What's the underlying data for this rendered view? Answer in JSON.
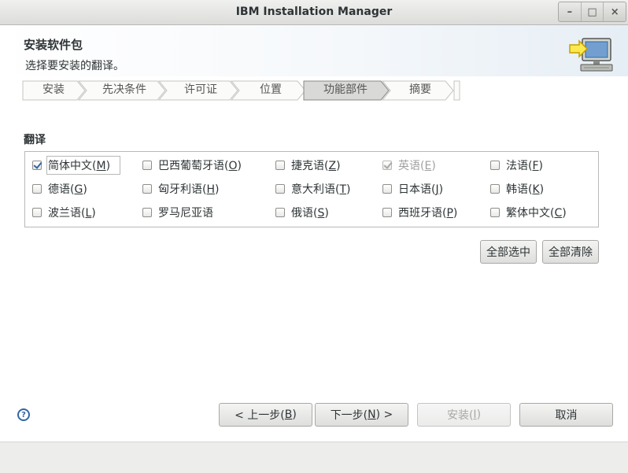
{
  "window": {
    "title": "IBM Installation Manager",
    "controls": [
      "–",
      "□",
      "×"
    ]
  },
  "header": {
    "title": "安装软件包",
    "subtitle": "选择要安装的翻译。",
    "icon": "computer-arrow-icon"
  },
  "steps": [
    {
      "label": "安装",
      "active": false
    },
    {
      "label": "先决条件",
      "active": false
    },
    {
      "label": "许可证",
      "active": false
    },
    {
      "label": "位置",
      "active": false
    },
    {
      "label": "功能部件",
      "active": true
    },
    {
      "label": "摘要",
      "active": false
    }
  ],
  "section": {
    "label": "翻译"
  },
  "languages": [
    {
      "label": "简体中文(M)",
      "checked": true,
      "disabled": false,
      "focused": true
    },
    {
      "label": "巴西葡萄牙语(O)",
      "checked": false,
      "disabled": false
    },
    {
      "label": "捷克语(Z)",
      "checked": false,
      "disabled": false
    },
    {
      "label": "英语(E)",
      "checked": true,
      "disabled": true
    },
    {
      "label": "法语(F)",
      "checked": false,
      "disabled": false
    },
    {
      "label": "德语(G)",
      "checked": false,
      "disabled": false
    },
    {
      "label": "匈牙利语(H)",
      "checked": false,
      "disabled": false
    },
    {
      "label": "意大利语(T)",
      "checked": false,
      "disabled": false
    },
    {
      "label": "日本语(J)",
      "checked": false,
      "disabled": false
    },
    {
      "label": "韩语(K)",
      "checked": false,
      "disabled": false
    },
    {
      "label": "波兰语(L)",
      "checked": false,
      "disabled": false
    },
    {
      "label": "罗马尼亚语",
      "checked": false,
      "disabled": false
    },
    {
      "label": "俄语(S)",
      "checked": false,
      "disabled": false
    },
    {
      "label": "西班牙语(P)",
      "checked": false,
      "disabled": false
    },
    {
      "label": "繁体中文(C)",
      "checked": false,
      "disabled": false
    }
  ],
  "actions": {
    "select_all": "全部选中",
    "clear_all": "全部清除"
  },
  "nav": {
    "back": "< 上一步(B)",
    "next": "下一步(N) >",
    "install": "安装(I)",
    "cancel": "取消"
  },
  "help": {
    "icon": "help-icon",
    "glyph": "?"
  },
  "colors": {
    "accent": "#3465a4",
    "active_step": "#d9d9d7"
  }
}
